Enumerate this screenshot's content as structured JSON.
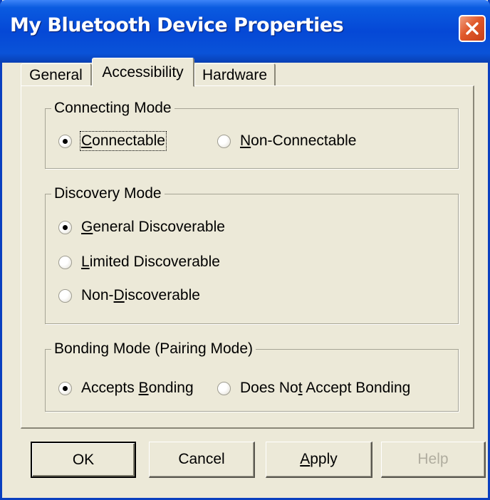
{
  "window": {
    "title": "My Bluetooth Device Properties"
  },
  "tabs": [
    {
      "label": "General",
      "active": false
    },
    {
      "label": "Accessibility",
      "active": true
    },
    {
      "label": "Hardware",
      "active": false
    }
  ],
  "connecting_mode": {
    "legend": "Connecting Mode",
    "options": [
      {
        "pre": "",
        "key": "C",
        "post": "onnectable",
        "checked": true
      },
      {
        "pre": "",
        "key": "N",
        "post": "on-Connectable",
        "checked": false
      }
    ]
  },
  "discovery_mode": {
    "legend": "Discovery Mode",
    "options": [
      {
        "pre": "",
        "key": "G",
        "post": "eneral Discoverable",
        "checked": true
      },
      {
        "pre": "",
        "key": "L",
        "post": "imited Discoverable",
        "checked": false
      },
      {
        "pre": "Non-",
        "key": "D",
        "post": "iscoverable",
        "checked": false
      }
    ]
  },
  "bonding_mode": {
    "legend": "Bonding Mode (Pairing Mode)",
    "options": [
      {
        "pre": "Accepts ",
        "key": "B",
        "post": "onding",
        "checked": true
      },
      {
        "pre": "Does No",
        "key": "t",
        "post": " Accept Bonding",
        "checked": false
      }
    ]
  },
  "buttons": {
    "ok": "OK",
    "cancel": "Cancel",
    "apply_key": "A",
    "apply_rest": "pply",
    "help": "Help"
  },
  "colors": {
    "title_bar": "#0548d6",
    "close_button": "#e0582a",
    "face": "#ece9d8"
  }
}
